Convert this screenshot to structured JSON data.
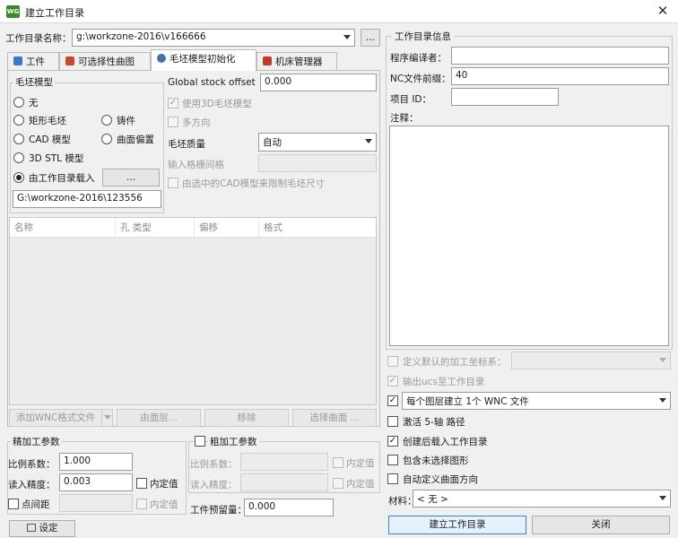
{
  "window": {
    "title": "建立工作目录",
    "app_icon": "WG",
    "close": "✕"
  },
  "left": {
    "dir_label": "工作目录名称：",
    "dir_value": "g:\\workzone-2016\\v166666",
    "browse_label": "...",
    "tabs": [
      {
        "label": "工件",
        "icon": "workpiece-icon"
      },
      {
        "label": "可选择性曲图",
        "icon": "surface-icon"
      },
      {
        "label": "毛坯模型初始化",
        "icon": "stock-icon"
      },
      {
        "label": "机床管理器",
        "icon": "machine-icon"
      }
    ],
    "stock_group_title": "毛坯模型",
    "stock_options": {
      "none": "无",
      "rect": "矩形毛坯",
      "cad": "CAD 模型",
      "stl": "3D STL 模型",
      "from_dir": "由工作目录载入",
      "casting": "铸件",
      "surface_offset": "曲面偏置"
    },
    "from_dir_browse": "...",
    "stock_path": "G:\\workzone-2016\\123556",
    "global_offset_label": "Global stock offset",
    "global_offset_value": "0.000",
    "use_3d_stock": "使用3D毛坯模型",
    "multi_dir": "多方向",
    "stock_quality_label": "毛坯质量",
    "stock_quality_value": "自动",
    "input_grid_label": "输入格栅间格",
    "limit_by_cad": "由选中的CAD模型来限制毛坯尺寸",
    "table_headers": [
      "名称",
      "孔 类型",
      "偏移",
      "格式"
    ],
    "buttons": {
      "add_wnc": "添加WNC格式文件",
      "from_surface": "由面层...",
      "remove": "移除",
      "select_surface": "选择曲面 ..."
    },
    "finish": {
      "title": "精加工参数",
      "scale_label": "比例系数：",
      "scale_value": "1.000",
      "tolerance_label": "读入精度：",
      "tolerance_value": "0.003",
      "inner_value": "内定值",
      "point_distance": "点间距",
      "inner_value2": "内定值"
    },
    "rough": {
      "title": "粗加工参数",
      "scale_label": "比例系数：",
      "inner_value": "内定值",
      "tolerance_label": "读入精度：",
      "inner_value2": "内定值"
    },
    "settings_button": "设定",
    "allowance_label": "工件预留量：",
    "allowance_value": "0.000"
  },
  "right": {
    "group_title": "工作目录信息",
    "programmer_label": "程序编译者：",
    "programmer_value": "",
    "nc_prefix_label": "NC文件前缀：",
    "nc_prefix_value": "40",
    "project_id_label": "项目 ID：",
    "project_id_value": "",
    "notes_label": "注释：",
    "notes_value": "",
    "define_coord": "定义默认的加工坐标系：",
    "output_ucs": "输出ucs至工作目录",
    "per_layer_value": "每个图层建立 1个 WNC 文件",
    "activate_5axis": "激活 5-轴 路径",
    "load_after_create": "创建后载入工作目录",
    "include_unselected": "包含未选择图形",
    "auto_surface_dir": "自动定义曲面方向",
    "material_label": "材料：",
    "material_value": "< 无 >",
    "create_button": "建立工作目录",
    "close_button": "关闭"
  }
}
